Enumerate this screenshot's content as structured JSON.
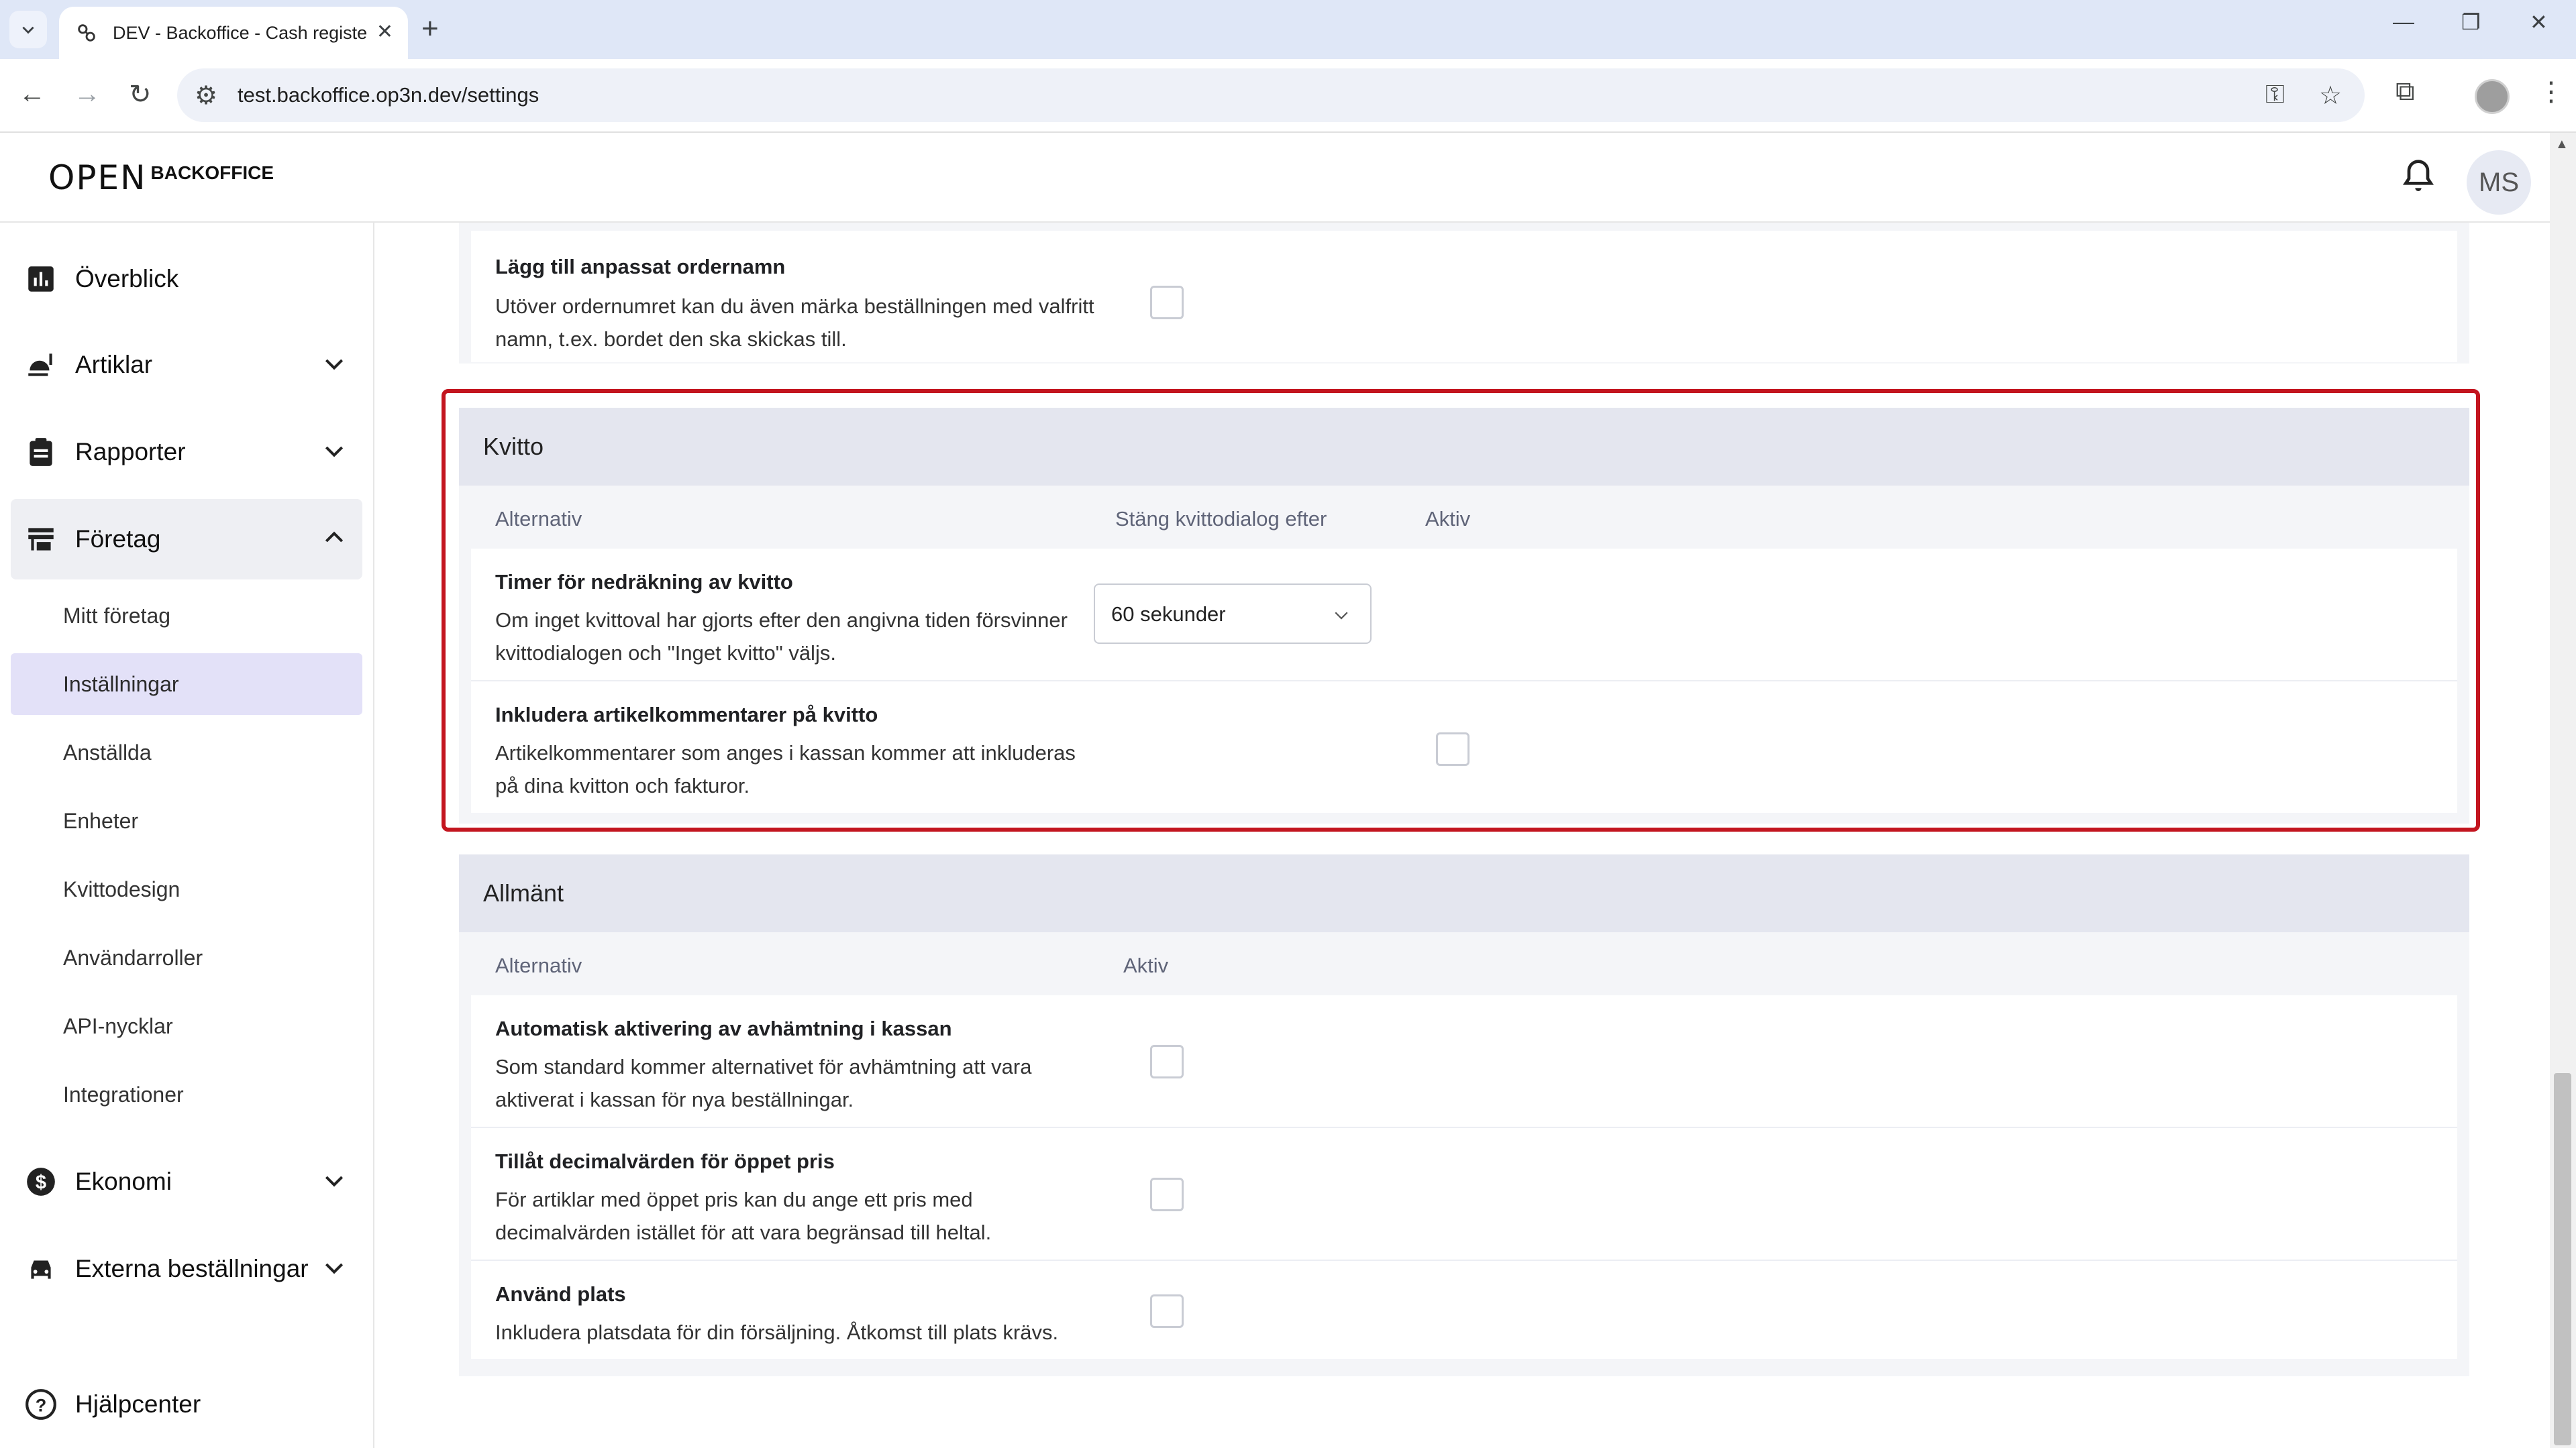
{
  "browser": {
    "tab_title": "DEV - Backoffice - Cash register",
    "url": "test.backoffice.op3n.dev/settings"
  },
  "header": {
    "logo_main": "OPEN",
    "logo_sub": "BACKOFFICE",
    "avatar_initials": "MS"
  },
  "sidebar": {
    "items": [
      {
        "label": "Överblick",
        "icon": "bar-chart-icon"
      },
      {
        "label": "Artiklar",
        "icon": "food-icon"
      },
      {
        "label": "Rapporter",
        "icon": "clipboard-icon"
      },
      {
        "label": "Företag",
        "icon": "store-icon"
      },
      {
        "label": "Ekonomi",
        "icon": "dollar-icon"
      },
      {
        "label": "Externa beställningar",
        "icon": "car-icon"
      }
    ],
    "sub_items": [
      "Mitt företag",
      "Inställningar",
      "Anställda",
      "Enheter",
      "Kvittodesign",
      "Användarroller",
      "API-nycklar",
      "Integrationer"
    ],
    "active_sub": "Inställningar",
    "help": "Hjälpcenter"
  },
  "top_section": {
    "row": {
      "title": "Lägg till anpassat ordernamn",
      "desc": "Utöver ordernumret kan du även märka beställningen med valfritt namn, t.ex. bordet den ska skickas till."
    }
  },
  "kvitto": {
    "title": "Kvitto",
    "col_option": "Alternativ",
    "col_close": "Stäng kvittodialog efter",
    "col_active": "Aktiv",
    "rows": [
      {
        "title": "Timer för nedräkning av kvitto",
        "desc": "Om inget kvittoval har gjorts efter den angivna tiden försvinner kvittodialogen och \"Inget kvitto\" väljs.",
        "select_value": "60 sekunder"
      },
      {
        "title": "Inkludera artikelkommentarer på kvitto",
        "desc": "Artikelkommentarer som anges i kassan kommer att inkluderas på dina kvitton och fakturor."
      }
    ]
  },
  "allmant": {
    "title": "Allmänt",
    "col_option": "Alternativ",
    "col_active": "Aktiv",
    "rows": [
      {
        "title": "Automatisk aktivering av avhämtning i kassan",
        "desc": "Som standard kommer alternativet för avhämtning att vara aktiverat i kassan för nya beställningar."
      },
      {
        "title": "Tillåt decimalvärden för öppet pris",
        "desc": "För artiklar med öppet pris kan du ange ett pris med decimalvärden istället för att vara begränsad till heltal."
      },
      {
        "title": "Använd plats",
        "desc": "Inkludera platsdata för din försäljning. Åtkomst till plats krävs."
      }
    ]
  },
  "colors": {
    "accent_highlight": "#c3151f",
    "active_sub_bg": "#e3e1f8",
    "card_head_bg": "#e4e6ef"
  }
}
